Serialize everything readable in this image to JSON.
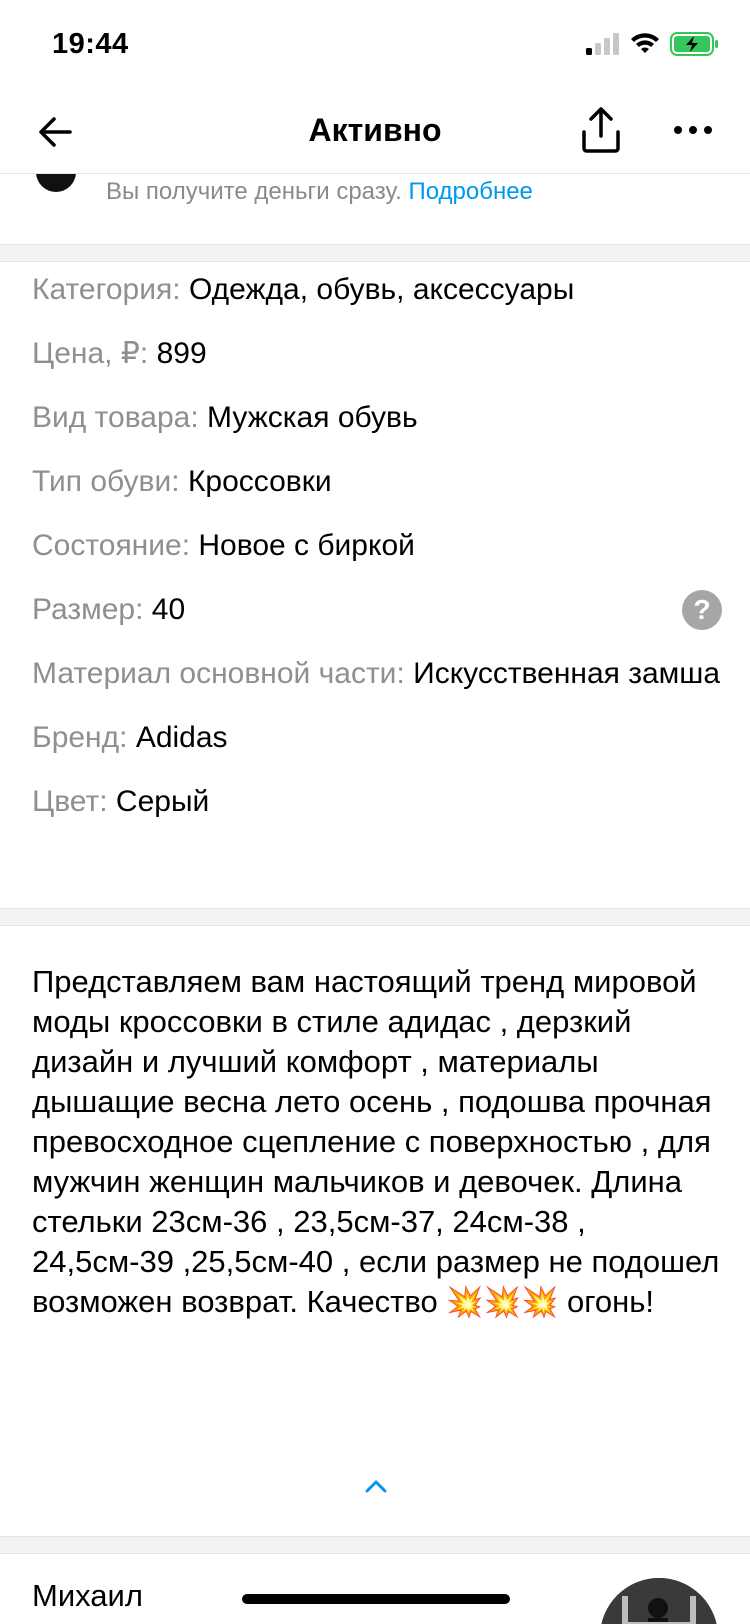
{
  "status_bar": {
    "time": "19:44"
  },
  "nav": {
    "title": "Активно"
  },
  "payment": {
    "text": "Вы получите деньги сразу.",
    "link": "Подробнее"
  },
  "params": [
    {
      "label": "Категория:",
      "value": "Одежда, обувь, аксессуары"
    },
    {
      "label": "Цена, ₽:",
      "value": "899"
    },
    {
      "label": "Вид товара:",
      "value": "Мужская обувь"
    },
    {
      "label": "Тип обуви:",
      "value": "Кроссовки"
    },
    {
      "label": "Состояние:",
      "value": "Новое с биркой"
    },
    {
      "label": "Размер:",
      "value": "40"
    },
    {
      "label": "Материал основной части:",
      "value": "Искусственная замша"
    },
    {
      "label": "Бренд:",
      "value": "Adidas"
    },
    {
      "label": "Цвет:",
      "value": "Серый"
    }
  ],
  "help_icon": "?",
  "description": {
    "text": "Представляем вам настоящий тренд мировой моды кроссовки в стиле адидас , дерзкий дизайн и лучший комфорт , материалы дышащие весна лето осень , подошва прочная превосходное сцепление с поверхностью , для мужчин женщин мальчиков и девочек. Длина стельки 23см-36 , 23,5см-37, 24см-38 , 24,5см-39 ,25,5см-40 , если размер не подошел возможен возврат. Качество",
    "emoji": "💥💥💥",
    "ending": "огонь!"
  },
  "seller": {
    "name": "Михаил"
  },
  "colors": {
    "link": "#0097ee",
    "label": "#8f8f8f",
    "battery": "#34c759"
  }
}
